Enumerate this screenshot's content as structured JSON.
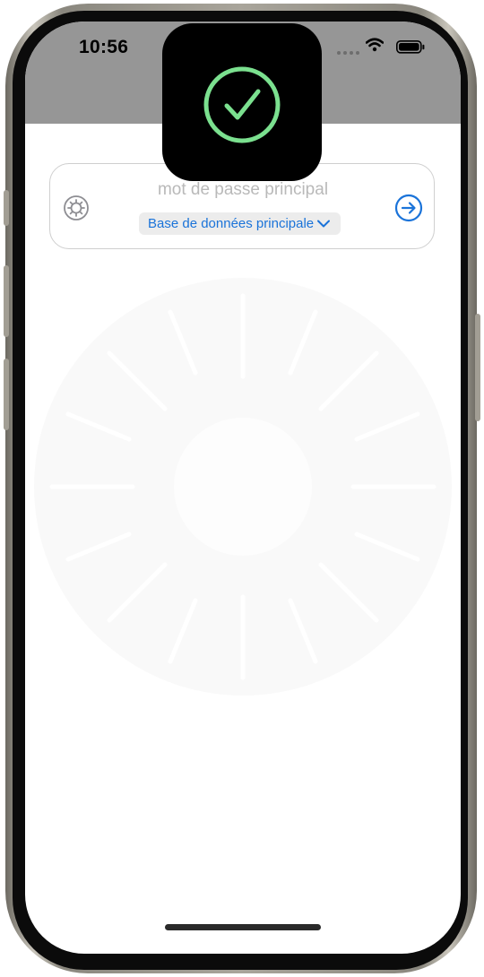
{
  "status_bar": {
    "time": "10:56"
  },
  "overlay": {
    "icon": "checkmark-circle-icon",
    "accent": "#7be08f"
  },
  "login": {
    "settings_icon": "gear-icon",
    "password_placeholder": "mot de passe principal",
    "password_value": "",
    "database_label": "Base de données principale",
    "database_icon": "chevron-down-icon",
    "submit_icon": "arrow-right-circle-icon",
    "accent": "#1a73d9"
  }
}
